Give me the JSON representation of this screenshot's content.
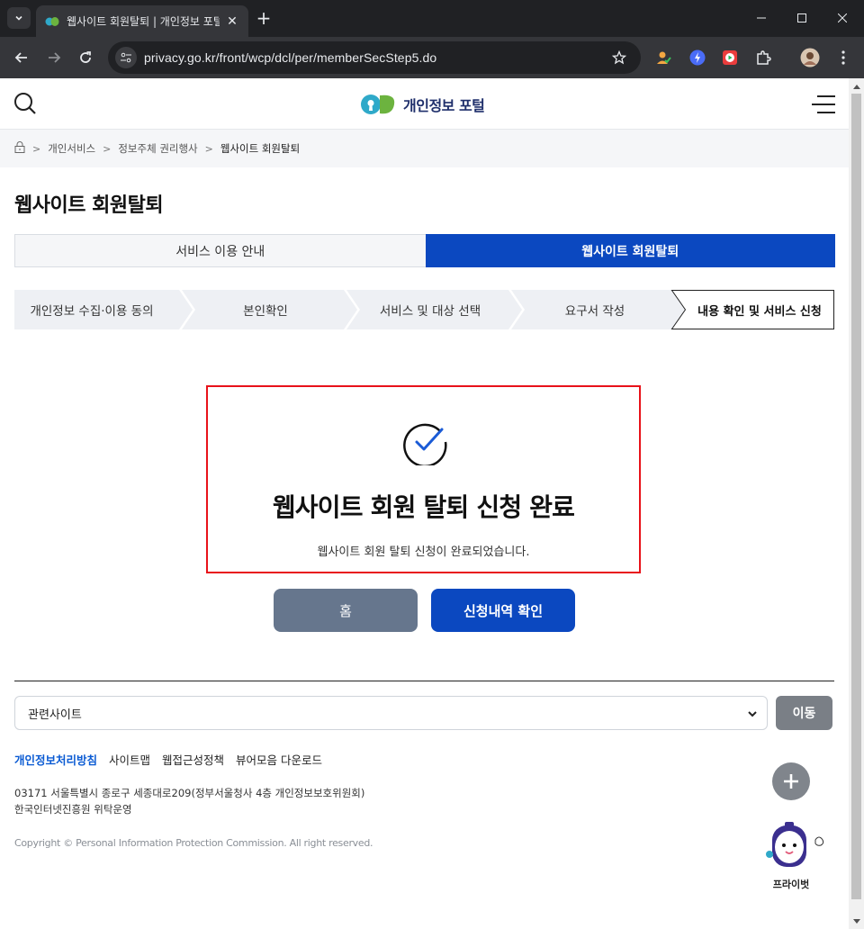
{
  "browser": {
    "tab_title": "웹사이트 회원탈퇴 | 개인정보 포털",
    "url": "privacy.go.kr/front/wcp/dcl/per/memberSecStep5.do",
    "icons": [
      "tab-search-icon",
      "close-icon",
      "plus-icon",
      "minimize-icon",
      "maximize-icon",
      "window-close-icon",
      "back-icon",
      "forward-icon",
      "reload-icon",
      "site-info-icon",
      "star-icon",
      "extension-icon",
      "profile-avatar",
      "more-vert-icon"
    ]
  },
  "header": {
    "logo_text": "개인정보 포털"
  },
  "breadcrumb": {
    "items": [
      "개인서비스",
      "정보주체 권리행사"
    ],
    "current": "웹사이트 회원탈퇴"
  },
  "page": {
    "title": "웹사이트 회원탈퇴"
  },
  "tabs": [
    {
      "label": "서비스 이용 안내",
      "active": false
    },
    {
      "label": "웹사이트 회원탈퇴",
      "active": true
    }
  ],
  "steps": [
    {
      "label": "개인정보 수집·이용 동의",
      "current": false
    },
    {
      "label": "본인확인",
      "current": false
    },
    {
      "label": "서비스 및 대상 선택",
      "current": false
    },
    {
      "label": "요구서 작성",
      "current": false
    },
    {
      "label": "내용 확인 및 서비스 신청",
      "current": true
    }
  ],
  "result": {
    "title": "웹사이트 회원 탈퇴 신청 완료",
    "description": "웹사이트 회원 탈퇴 신청이 완료되었습니다."
  },
  "actions": {
    "home_label": "홈",
    "history_label": "신청내역 확인"
  },
  "footer": {
    "related_sites_label": "관련사이트",
    "go_label": "이동",
    "links": [
      "개인정보처리방침",
      "사이트맵",
      "웹접근성정책",
      "뷰어모음 다운로드"
    ],
    "address_line1": "03171 서울특별시 종로구 세종대로209(정부서울청사 4층 개인정보보호위원회)",
    "address_line2": "한국인터넷진흥원 위탁운영",
    "copyright": "Copyright © Personal Information Protection Commission. All right reserved."
  },
  "chatbot": {
    "label": "프라이벗"
  },
  "colors": {
    "primary_blue": "#0b48c0",
    "highlight_red": "#e8121a",
    "home_button": "#66768d",
    "chrome_dark": "#202124",
    "chrome_toolbar": "#35363a"
  }
}
